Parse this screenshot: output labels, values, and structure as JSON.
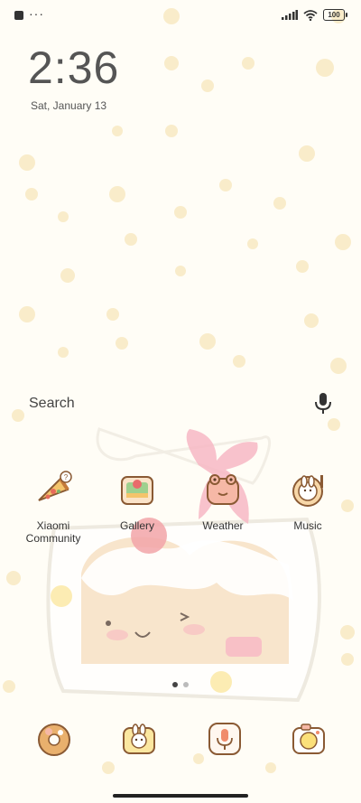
{
  "status_bar": {
    "notification_icons": [
      "app-square-icon",
      "more-dots-icon"
    ],
    "signal_icon": "cell-signal-icon",
    "wifi_icon": "wifi-icon",
    "battery_level": "100"
  },
  "lock": {
    "time": "2:36",
    "date": "Sat, January 13"
  },
  "search": {
    "label": "Search",
    "mic_icon": "microphone-icon"
  },
  "apps": [
    {
      "label": "Xiaomi Community",
      "icon": "pizza-icon"
    },
    {
      "label": "Gallery",
      "icon": "gallery-cake-icon"
    },
    {
      "label": "Weather",
      "icon": "frog-weather-icon"
    },
    {
      "label": "Music",
      "icon": "bunny-music-icon"
    }
  ],
  "pager": {
    "pages": 2,
    "current": 1
  },
  "dock": [
    {
      "icon": "phone-donut-icon"
    },
    {
      "icon": "messages-bunny-icon"
    },
    {
      "icon": "recorder-mic-icon"
    },
    {
      "icon": "camera-lemon-icon"
    }
  ],
  "colors": {
    "background": "#fffdf6",
    "wallpaper_accent": "#f4dfa5",
    "text": "#333333",
    "ribbon": "#f7b7c4"
  }
}
